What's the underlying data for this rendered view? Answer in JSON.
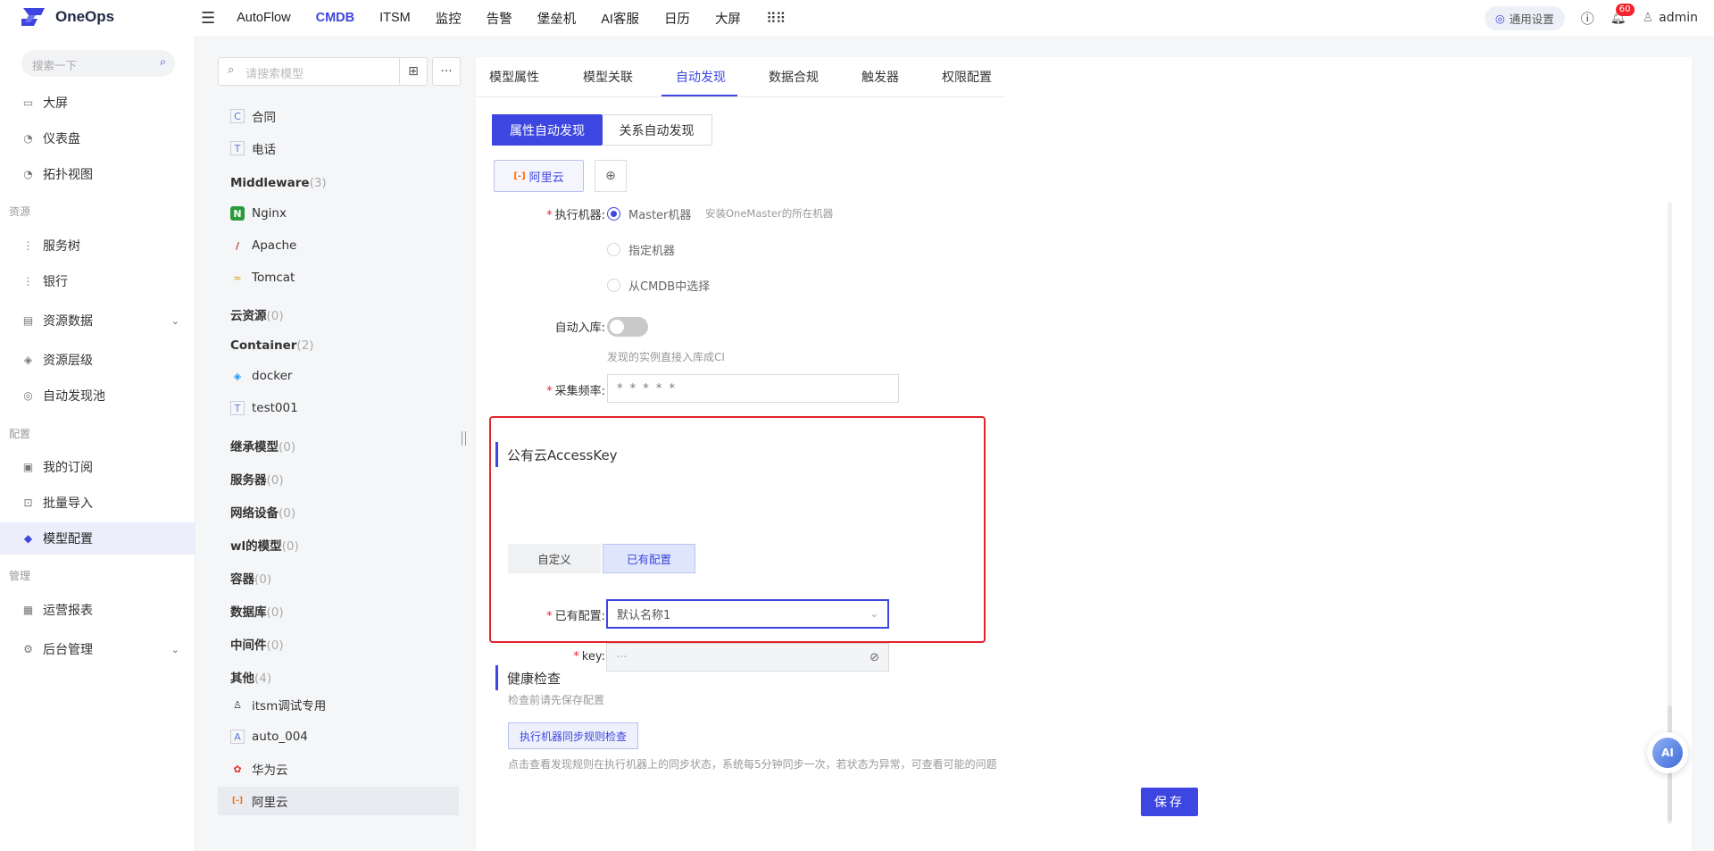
{
  "app": {
    "name": "OneOps"
  },
  "nav": [
    "AutoFlow",
    "CMDB",
    "ITSM",
    "监控",
    "告警",
    "堡垒机",
    "AI客服",
    "日历",
    "大屏"
  ],
  "nav_active": "CMDB",
  "topbar": {
    "general_settings": "通用设置",
    "notification_count": "60",
    "user": "admin"
  },
  "sidebar": {
    "search_placeholder": "搜索一下",
    "items": [
      {
        "label": "大屏",
        "icon": "monitor-icon"
      },
      {
        "label": "仪表盘",
        "icon": "dashboard-icon"
      },
      {
        "label": "拓扑视图",
        "icon": "topology-icon"
      },
      {
        "label": "服务树",
        "icon": "tree-icon"
      },
      {
        "label": "银行",
        "icon": "bank-icon"
      },
      {
        "label": "资源数据",
        "icon": "data-icon"
      },
      {
        "label": "资源层级",
        "icon": "layers-icon"
      },
      {
        "label": "自动发现池",
        "icon": "discover-icon"
      },
      {
        "label": "我的订阅",
        "icon": "bookmark-icon"
      },
      {
        "label": "批量导入",
        "icon": "import-icon"
      },
      {
        "label": "模型配置",
        "icon": "model-config-icon"
      },
      {
        "label": "运营报表",
        "icon": "report-icon"
      },
      {
        "label": "后台管理",
        "icon": "gear-icon"
      }
    ],
    "sections": [
      "资源",
      "配置",
      "管理"
    ]
  },
  "tree": {
    "search_placeholder": "请搜索模型",
    "leaves": [
      {
        "label": "合同",
        "icon": "C"
      },
      {
        "label": "电话",
        "icon": "T"
      },
      {
        "label": "Nginx",
        "icon": "N"
      },
      {
        "label": "Apache",
        "icon": "/"
      },
      {
        "label": "Tomcat",
        "icon": "≈"
      },
      {
        "label": "docker",
        "icon": "◈"
      },
      {
        "label": "test001",
        "icon": "T"
      },
      {
        "label": "itsm调试专用",
        "icon": "♙"
      },
      {
        "label": "auto_004",
        "icon": "A"
      },
      {
        "label": "华为云",
        "icon": "✿"
      },
      {
        "label": "阿里云",
        "icon": "[-]"
      }
    ],
    "groups": [
      {
        "name": "Middleware",
        "count": "(3)"
      },
      {
        "name": "云资源",
        "count": "(0)"
      },
      {
        "name": "Container",
        "count": "(2)"
      },
      {
        "name": "继承模型",
        "count": "(0)"
      },
      {
        "name": "服务器",
        "count": "(0)"
      },
      {
        "name": "网络设备",
        "count": "(0)"
      },
      {
        "name": "wl的模型",
        "count": "(0)"
      },
      {
        "name": "容器",
        "count": "(0)"
      },
      {
        "name": "数据库",
        "count": "(0)"
      },
      {
        "name": "中间件",
        "count": "(0)"
      },
      {
        "name": "其他",
        "count": "(4)"
      }
    ]
  },
  "tabs": [
    "模型属性",
    "模型关联",
    "自动发现",
    "数据合规",
    "触发器",
    "权限配置"
  ],
  "discover": {
    "attr_btn": "属性自动发现",
    "rel_btn": "关系自动发现",
    "chip": "阿里云",
    "exec_label": "执行机器",
    "radio_master": "Master机器",
    "master_hint": "安装OneMaster的所在机器",
    "radio_specify": "指定机器",
    "radio_cmdb": "从CMDB中选择",
    "auto_label": "自动入库",
    "auto_hint": "发现的实例直接入库成CI",
    "freq_label": "采集频率",
    "freq_value": "* * * * *",
    "access_title": "公有云AccessKey",
    "seg_custom": "自定义",
    "seg_existing": "已有配置",
    "existing_label": "已有配置",
    "existing_value": "默认名称1",
    "key_label": "key",
    "key_value": "···",
    "health_title": "健康检查",
    "health_hint": "检查前请先保存配置",
    "health_btn": "执行机器同步规则检查",
    "health_desc": "点击查看发现规则在执行机器上的同步状态，系统每5分钟同步一次，若状态为异常，可查看可能的问题",
    "save": "保存"
  },
  "ai_float": "AI",
  "colors": {
    "accent": "#3d46e0",
    "highlight": "#e4222a"
  }
}
